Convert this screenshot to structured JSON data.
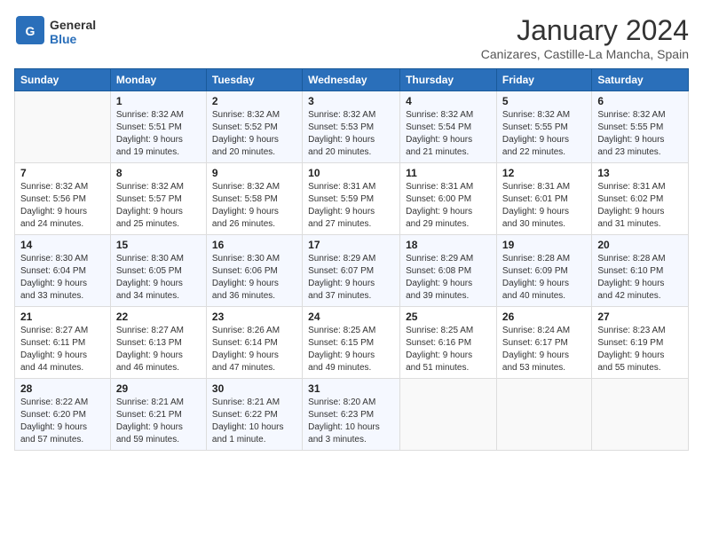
{
  "logo": {
    "general": "General",
    "blue": "Blue"
  },
  "header": {
    "month": "January 2024",
    "location": "Canizares, Castille-La Mancha, Spain"
  },
  "days_of_week": [
    "Sunday",
    "Monday",
    "Tuesday",
    "Wednesday",
    "Thursday",
    "Friday",
    "Saturday"
  ],
  "weeks": [
    [
      {
        "day": "",
        "info": ""
      },
      {
        "day": "1",
        "info": "Sunrise: 8:32 AM\nSunset: 5:51 PM\nDaylight: 9 hours\nand 19 minutes."
      },
      {
        "day": "2",
        "info": "Sunrise: 8:32 AM\nSunset: 5:52 PM\nDaylight: 9 hours\nand 20 minutes."
      },
      {
        "day": "3",
        "info": "Sunrise: 8:32 AM\nSunset: 5:53 PM\nDaylight: 9 hours\nand 20 minutes."
      },
      {
        "day": "4",
        "info": "Sunrise: 8:32 AM\nSunset: 5:54 PM\nDaylight: 9 hours\nand 21 minutes."
      },
      {
        "day": "5",
        "info": "Sunrise: 8:32 AM\nSunset: 5:55 PM\nDaylight: 9 hours\nand 22 minutes."
      },
      {
        "day": "6",
        "info": "Sunrise: 8:32 AM\nSunset: 5:55 PM\nDaylight: 9 hours\nand 23 minutes."
      }
    ],
    [
      {
        "day": "7",
        "info": "Sunrise: 8:32 AM\nSunset: 5:56 PM\nDaylight: 9 hours\nand 24 minutes."
      },
      {
        "day": "8",
        "info": "Sunrise: 8:32 AM\nSunset: 5:57 PM\nDaylight: 9 hours\nand 25 minutes."
      },
      {
        "day": "9",
        "info": "Sunrise: 8:32 AM\nSunset: 5:58 PM\nDaylight: 9 hours\nand 26 minutes."
      },
      {
        "day": "10",
        "info": "Sunrise: 8:31 AM\nSunset: 5:59 PM\nDaylight: 9 hours\nand 27 minutes."
      },
      {
        "day": "11",
        "info": "Sunrise: 8:31 AM\nSunset: 6:00 PM\nDaylight: 9 hours\nand 29 minutes."
      },
      {
        "day": "12",
        "info": "Sunrise: 8:31 AM\nSunset: 6:01 PM\nDaylight: 9 hours\nand 30 minutes."
      },
      {
        "day": "13",
        "info": "Sunrise: 8:31 AM\nSunset: 6:02 PM\nDaylight: 9 hours\nand 31 minutes."
      }
    ],
    [
      {
        "day": "14",
        "info": "Sunrise: 8:30 AM\nSunset: 6:04 PM\nDaylight: 9 hours\nand 33 minutes."
      },
      {
        "day": "15",
        "info": "Sunrise: 8:30 AM\nSunset: 6:05 PM\nDaylight: 9 hours\nand 34 minutes."
      },
      {
        "day": "16",
        "info": "Sunrise: 8:30 AM\nSunset: 6:06 PM\nDaylight: 9 hours\nand 36 minutes."
      },
      {
        "day": "17",
        "info": "Sunrise: 8:29 AM\nSunset: 6:07 PM\nDaylight: 9 hours\nand 37 minutes."
      },
      {
        "day": "18",
        "info": "Sunrise: 8:29 AM\nSunset: 6:08 PM\nDaylight: 9 hours\nand 39 minutes."
      },
      {
        "day": "19",
        "info": "Sunrise: 8:28 AM\nSunset: 6:09 PM\nDaylight: 9 hours\nand 40 minutes."
      },
      {
        "day": "20",
        "info": "Sunrise: 8:28 AM\nSunset: 6:10 PM\nDaylight: 9 hours\nand 42 minutes."
      }
    ],
    [
      {
        "day": "21",
        "info": "Sunrise: 8:27 AM\nSunset: 6:11 PM\nDaylight: 9 hours\nand 44 minutes."
      },
      {
        "day": "22",
        "info": "Sunrise: 8:27 AM\nSunset: 6:13 PM\nDaylight: 9 hours\nand 46 minutes."
      },
      {
        "day": "23",
        "info": "Sunrise: 8:26 AM\nSunset: 6:14 PM\nDaylight: 9 hours\nand 47 minutes."
      },
      {
        "day": "24",
        "info": "Sunrise: 8:25 AM\nSunset: 6:15 PM\nDaylight: 9 hours\nand 49 minutes."
      },
      {
        "day": "25",
        "info": "Sunrise: 8:25 AM\nSunset: 6:16 PM\nDaylight: 9 hours\nand 51 minutes."
      },
      {
        "day": "26",
        "info": "Sunrise: 8:24 AM\nSunset: 6:17 PM\nDaylight: 9 hours\nand 53 minutes."
      },
      {
        "day": "27",
        "info": "Sunrise: 8:23 AM\nSunset: 6:19 PM\nDaylight: 9 hours\nand 55 minutes."
      }
    ],
    [
      {
        "day": "28",
        "info": "Sunrise: 8:22 AM\nSunset: 6:20 PM\nDaylight: 9 hours\nand 57 minutes."
      },
      {
        "day": "29",
        "info": "Sunrise: 8:21 AM\nSunset: 6:21 PM\nDaylight: 9 hours\nand 59 minutes."
      },
      {
        "day": "30",
        "info": "Sunrise: 8:21 AM\nSunset: 6:22 PM\nDaylight: 10 hours\nand 1 minute."
      },
      {
        "day": "31",
        "info": "Sunrise: 8:20 AM\nSunset: 6:23 PM\nDaylight: 10 hours\nand 3 minutes."
      },
      {
        "day": "",
        "info": ""
      },
      {
        "day": "",
        "info": ""
      },
      {
        "day": "",
        "info": ""
      }
    ]
  ]
}
